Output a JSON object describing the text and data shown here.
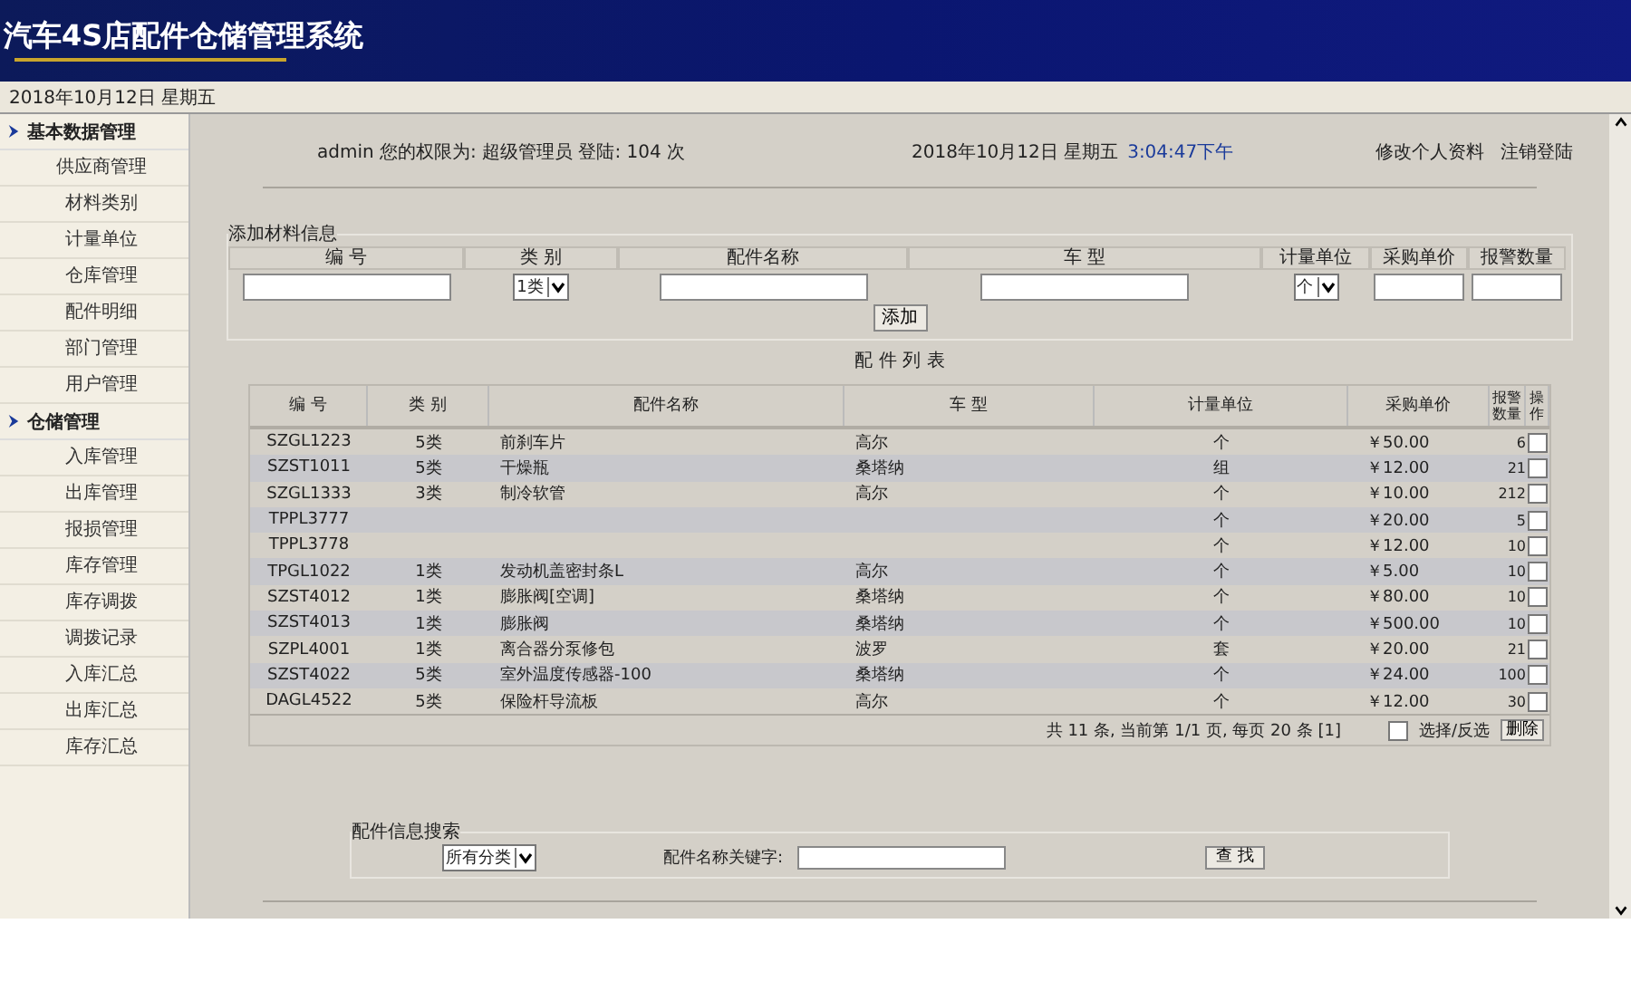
{
  "header": {
    "title": "汽车4S店配件仓储管理系统",
    "date": "2018年10月12日 星期五"
  },
  "sidebar": [
    {
      "label": "基本数据管理",
      "children": [
        {
          "label": "供应商管理"
        },
        {
          "label": "材料类别"
        },
        {
          "label": "计量单位"
        },
        {
          "label": "仓库管理"
        },
        {
          "label": "配件明细"
        },
        {
          "label": "部门管理"
        },
        {
          "label": "用户管理"
        }
      ]
    },
    {
      "label": "仓储管理",
      "children": [
        {
          "label": "入库管理"
        },
        {
          "label": "出库管理"
        },
        {
          "label": "报损管理"
        },
        {
          "label": "库存管理"
        },
        {
          "label": "库存调拨"
        },
        {
          "label": "调拨记录"
        },
        {
          "label": "入库汇总"
        },
        {
          "label": "出库汇总"
        },
        {
          "label": "库存汇总"
        }
      ]
    }
  ],
  "topbar": {
    "user_info": "admin 您的权限为: 超级管理员 登陆: 104 次",
    "date": "2018年10月12日 星期五",
    "time": "3:04:47下午",
    "links": [
      "修改个人资料",
      "注销登陆"
    ]
  },
  "add_form": {
    "legend": "添加材料信息",
    "columns": [
      "编 号",
      "类 别",
      "配件名称",
      "车 型",
      "计量单位",
      "采购单价",
      "报警数量"
    ],
    "category": "1类",
    "unit": "个",
    "button": "添加"
  },
  "list": {
    "title": "配 件 列 表",
    "columns": [
      "编 号",
      "类 别",
      "配件名称",
      "车 型",
      "计量单位",
      "采购单价",
      "报警数量",
      "操作"
    ],
    "rows": [
      {
        "code": "SZGL1223",
        "category": "5类",
        "name": "前刹车片",
        "car": "高尔",
        "unit": "个",
        "price": "￥50.00",
        "alarm": "6",
        "checked": false
      },
      {
        "code": "SZST1011",
        "category": "5类",
        "name": "干燥瓶",
        "car": "桑塔纳",
        "unit": "组",
        "price": "￥12.00",
        "alarm": "21",
        "checked": false
      },
      {
        "code": "SZGL1333",
        "category": "3类",
        "name": "制冷软管",
        "car": "高尔",
        "unit": "个",
        "price": "￥10.00",
        "alarm": "212",
        "checked": false
      },
      {
        "code": "TPPL3777",
        "unit": "个",
        "price": "￥20.00",
        "alarm": "5",
        "checked": false
      },
      {
        "code": "TPPL3778",
        "unit": "个",
        "price": "￥12.00",
        "alarm": "10",
        "checked": false
      },
      {
        "code": "TPGL1022",
        "category": "1类",
        "name": "发动机盖密封条L",
        "car": "高尔",
        "unit": "个",
        "price": "￥5.00",
        "alarm": "10",
        "checked": false
      },
      {
        "code": "SZST4012",
        "category": "1类",
        "name": "膨胀阀[空调]",
        "car": "桑塔纳",
        "unit": "个",
        "price": "￥80.00",
        "alarm": "10",
        "checked": false
      },
      {
        "code": "SZST4013",
        "category": "1类",
        "name": "膨胀阀",
        "car": "桑塔纳",
        "unit": "个",
        "price": "￥500.00",
        "alarm": "10",
        "checked": false
      },
      {
        "code": "SZPL4001",
        "category": "1类",
        "name": "离合器分泵修包",
        "car": "波罗",
        "unit": "套",
        "price": "￥20.00",
        "alarm": "21",
        "checked": false
      },
      {
        "code": "SZST4022",
        "category": "5类",
        "name": "室外温度传感器-100",
        "car": "桑塔纳",
        "unit": "个",
        "price": "￥24.00",
        "alarm": "100",
        "checked": false
      },
      {
        "code": "DAGL4522",
        "category": "5类",
        "name": "保险杆导流板",
        "car": "高尔",
        "unit": "个",
        "price": "￥12.00",
        "alarm": "30",
        "checked": false
      }
    ],
    "pager": "共 11 条, 当前第 1/1 页, 每页 20 条 [1]",
    "select_all": {
      "label": "选择/反选",
      "checked": false
    },
    "delete_button": "删除"
  },
  "search": {
    "legend": "配件信息搜索",
    "category": "所有分类",
    "keyword_label": "配件名称关键字:",
    "button": "查 找"
  }
}
